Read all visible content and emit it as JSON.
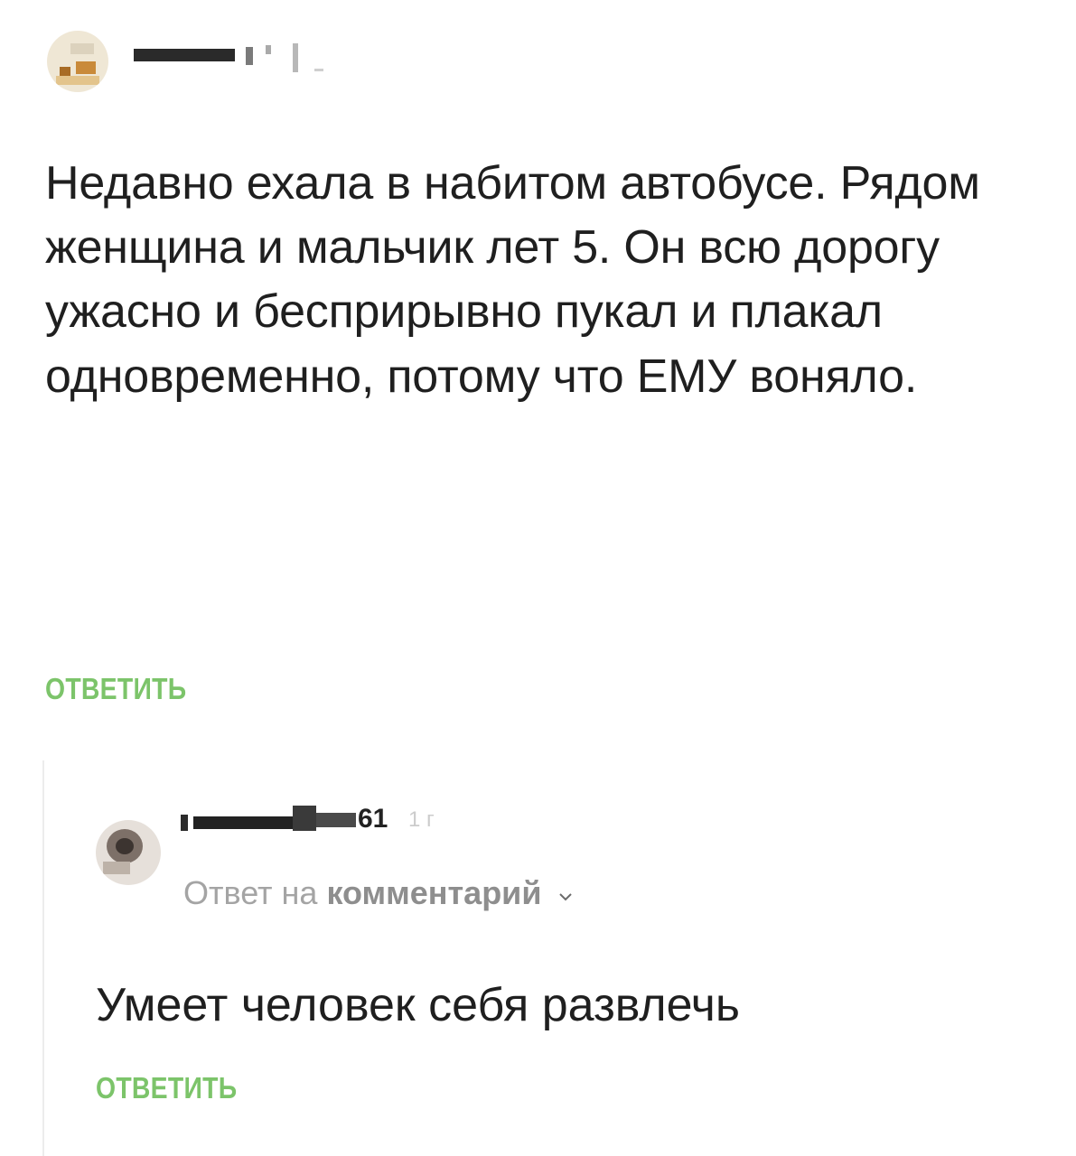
{
  "comments": [
    {
      "text": "Недавно ехала в набитом автобусе. Рядом женщина и мальчик лет 5. Он всю дорогу ужасно и бесприрывно пукал и плакал одновременно, потому что ЕМУ воняло.",
      "reply_label": "ОТВЕТИТЬ"
    },
    {
      "username_suffix": "61",
      "timestamp": "1 г",
      "reply_to_prefix": "Ответ на",
      "reply_to_target": "комментарий",
      "text": "Умеет человек себя развлечь",
      "reply_label": "ОТВЕТИТЬ"
    }
  ],
  "colors": {
    "reply_link": "#7cc46a",
    "text": "#1f1f1f",
    "muted": "#a4a4a4"
  },
  "icons": {
    "reply_to_dropdown": "chevron-down-icon"
  }
}
